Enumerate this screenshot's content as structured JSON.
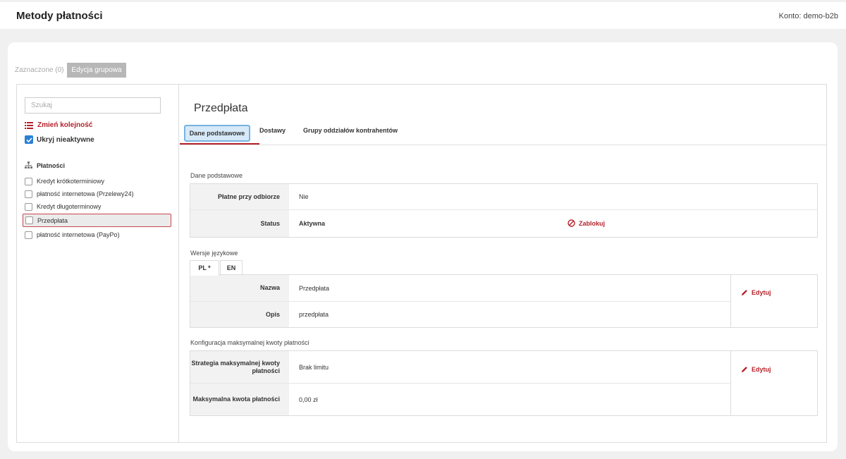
{
  "header": {
    "title": "Metody płatności",
    "account": "Konto: demo-b2b"
  },
  "toolbar": {
    "selected_label": "Zaznaczone (0)",
    "group_edit_label": "Edycja grupowa"
  },
  "sidebar": {
    "search_placeholder": "Szukaj",
    "reorder_label": "Zmień kolejność",
    "hide_inactive_label": "Ukryj nieaktywne",
    "tree_header": "Płatności",
    "items": [
      {
        "label": "Kredyt krótkoterminiowy"
      },
      {
        "label": "płatność internetowa (Przelewy24)"
      },
      {
        "label": "Kredyt długoterminowy"
      },
      {
        "label": "Przedpłata"
      },
      {
        "label": "płatność internetowa (PayPo)"
      }
    ]
  },
  "detail": {
    "title": "Przedpłata",
    "tabs": [
      {
        "label": "Dane podstawowe"
      },
      {
        "label": "Dostawy"
      },
      {
        "label": "Grupy oddziałów kontrahentów"
      }
    ],
    "basic": {
      "section_label": "Dane podstawowe",
      "cash_on_delivery_label": "Płatne przy odbiorze",
      "cash_on_delivery_value": "Nie",
      "status_label": "Status",
      "status_value": "Aktywna",
      "block_label": "Zablokuj"
    },
    "languages": {
      "section_label": "Wersje językowe",
      "tabs": [
        {
          "label": "PL *"
        },
        {
          "label": "EN"
        }
      ],
      "name_label": "Nazwa",
      "name_value": "Przedpłata",
      "desc_label": "Opis",
      "desc_value": "przedpłata",
      "edit_label": "Edytuj"
    },
    "limit": {
      "section_label": "Konfiguracja maksymalnej kwoty płatności",
      "strategy_label": "Strategia maksymalnej kwoty płatności",
      "strategy_value": "Brak limitu",
      "max_label": "Maksymalna kwota płatności",
      "max_value": "0,00 zł",
      "edit_label": "Edytuj"
    }
  },
  "colors": {
    "accent": "#b4222a",
    "checkbox": "#2a7fd6",
    "active_tab_bg": "#d6e9f8"
  }
}
